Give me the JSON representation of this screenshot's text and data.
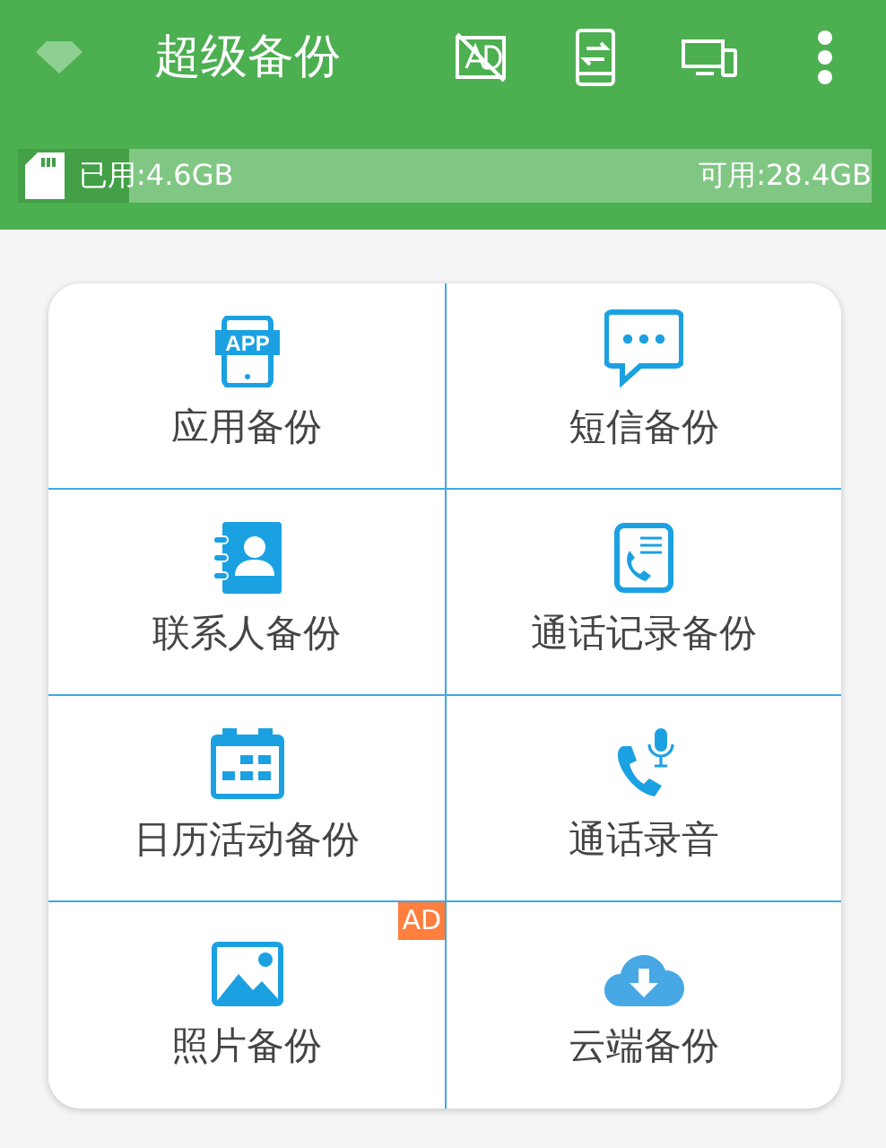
{
  "app_bar": {
    "title": "超级备份",
    "actions": [
      {
        "kind": "no-ads"
      },
      {
        "kind": "transfer"
      },
      {
        "kind": "devices"
      },
      {
        "kind": "more"
      }
    ]
  },
  "storage": {
    "used": "已用:4.6GB",
    "available": "可用:28.4GB",
    "level": 0.13
  },
  "tiles": [
    {
      "kind": "app",
      "icon_text": "APP",
      "label": "应用备份"
    },
    {
      "kind": "sms",
      "label": "短信备份"
    },
    {
      "kind": "contacts",
      "label": "联系人备份"
    },
    {
      "kind": "call-log",
      "label": "通话记录备份"
    },
    {
      "kind": "calendar",
      "label": "日历活动备份"
    },
    {
      "kind": "recording",
      "label": "通话录音"
    },
    {
      "kind": "photo",
      "label": "照片备份",
      "badge": "AD"
    },
    {
      "kind": "cloud",
      "label": "云端备份"
    }
  ]
}
